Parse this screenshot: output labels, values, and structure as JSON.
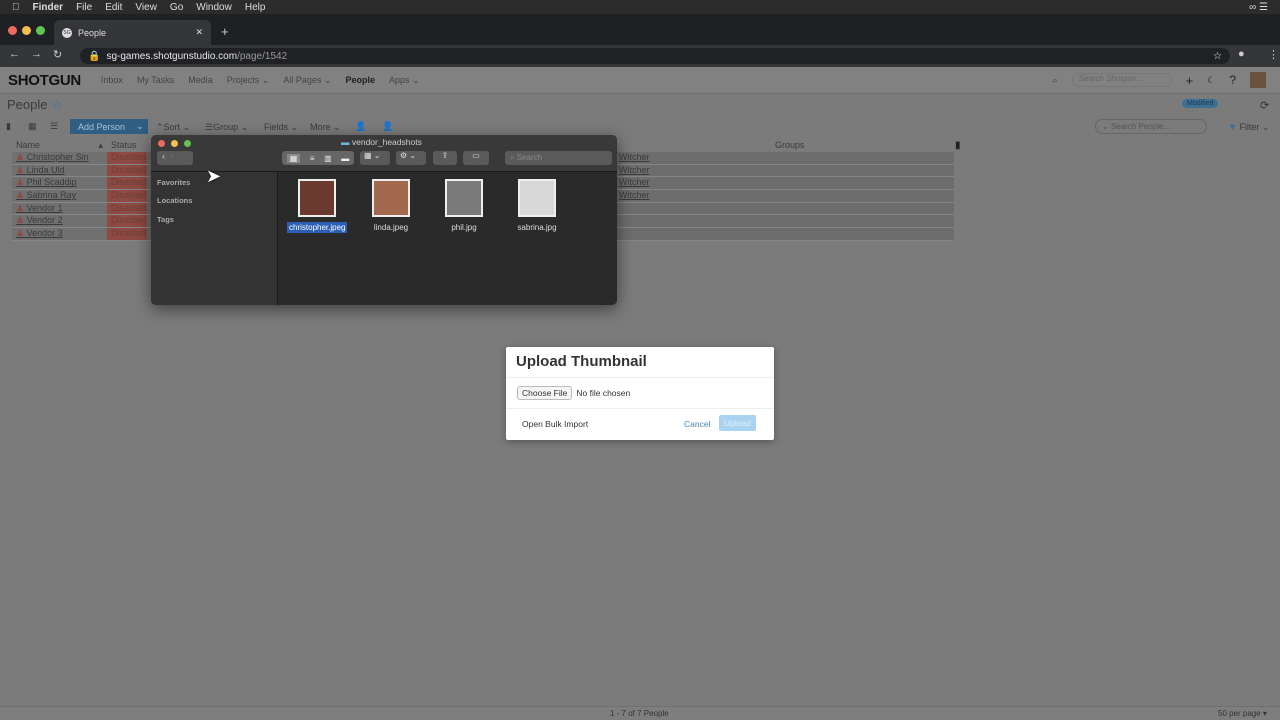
{
  "menubar": {
    "app": "Finder",
    "items": [
      "File",
      "Edit",
      "View",
      "Go",
      "Window",
      "Help"
    ]
  },
  "browser": {
    "tab_title": "People",
    "tab_favicon": "SG",
    "url_host": "sg-games.shotgunstudio.com",
    "url_path": "/page/1542"
  },
  "nav": {
    "logo": "SHOTGUN",
    "items": [
      "Inbox",
      "My Tasks",
      "Media",
      "Projects ⌄",
      "All Pages ⌄",
      "People",
      "Apps ⌄"
    ],
    "search_placeholder": "Search Shotgun..."
  },
  "page": {
    "title": "People",
    "modified_badge": "Modified",
    "search_placeholder": "Search People...",
    "filter": "Filter"
  },
  "toolbar": {
    "add_person": "Add Person",
    "sort": "Sort",
    "group": "Group",
    "fields": "Fields",
    "more": "More"
  },
  "table": {
    "headers": {
      "name": "Name",
      "status": "Status",
      "groups": "Groups"
    },
    "rows": [
      {
        "name": "Christopher Sin",
        "status": "Disabled",
        "project": "Witcher"
      },
      {
        "name": "Linda Uld",
        "status": "Disabled",
        "project": "Witcher"
      },
      {
        "name": "Phil Scaddip",
        "status": "Disabled",
        "project": "Witcher"
      },
      {
        "name": "Sabrina Ray",
        "status": "Disabled",
        "project": "Witcher"
      },
      {
        "name": "Vendor 1",
        "status": "Disabled",
        "project": ""
      },
      {
        "name": "Vendor 2",
        "status": "Disabled",
        "project": ""
      },
      {
        "name": "Vendor 3",
        "status": "Disabled",
        "project": ""
      }
    ]
  },
  "finder": {
    "title": "vendor_headshots",
    "search_placeholder": "Search",
    "sidebar": [
      "Favorites",
      "Locations",
      "Tags"
    ],
    "files": [
      {
        "name": "christopher.jpeg",
        "selected": true
      },
      {
        "name": "linda.jpeg"
      },
      {
        "name": "phil.jpg"
      },
      {
        "name": "sabrina.jpg"
      }
    ]
  },
  "dialog": {
    "title": "Upload Thumbnail",
    "choose_file": "Choose File",
    "no_file": "No file chosen",
    "bulk_import": "Open Bulk Import",
    "cancel": "Cancel",
    "upload": "Upload"
  },
  "footer": {
    "count": "1 - 7 of 7 People",
    "per_page": "50 per page ▾"
  }
}
